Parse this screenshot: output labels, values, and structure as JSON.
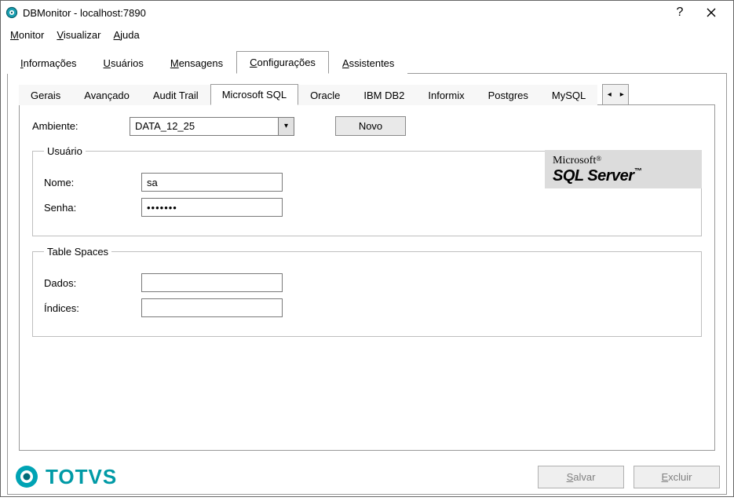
{
  "window": {
    "title": "DBMonitor - localhost:7890"
  },
  "menubar": [
    {
      "label": "Monitor",
      "accel_index": 0
    },
    {
      "label": "Visualizar",
      "accel_index": 0
    },
    {
      "label": "Ajuda",
      "accel_index": 0
    }
  ],
  "outer_tabs": {
    "items": [
      {
        "label": "Informações",
        "accel_index": 0
      },
      {
        "label": "Usuários",
        "accel_index": 0
      },
      {
        "label": "Mensagens",
        "accel_index": 0
      },
      {
        "label": "Configurações",
        "accel_index": 0,
        "active": true
      },
      {
        "label": "Assistentes",
        "accel_index": 0
      }
    ]
  },
  "inner_tabs": {
    "items": [
      {
        "label": "Gerais"
      },
      {
        "label": "Avançado"
      },
      {
        "label": "Audit Trail"
      },
      {
        "label": "Microsoft SQL",
        "active": true
      },
      {
        "label": "Oracle"
      },
      {
        "label": "IBM DB2"
      },
      {
        "label": "Informix"
      },
      {
        "label": "Postgres"
      },
      {
        "label": "MySQL"
      }
    ]
  },
  "form": {
    "ambiente_label": "Ambiente:",
    "ambiente_value": "DATA_12_25",
    "novo_label": "Novo",
    "usuario_legend": "Usuário",
    "nome_label": "Nome:",
    "nome_value": "sa",
    "senha_label": "Senha:",
    "senha_value": "•••••••",
    "tablespaces_legend": "Table Spaces",
    "dados_label": "Dados:",
    "dados_value": "",
    "indices_label": "Índices:",
    "indices_value": ""
  },
  "logo": {
    "microsoft": "Microsoft",
    "sqlserver": "SQL Server"
  },
  "footer": {
    "brand": "TOTVS",
    "salvar": "Salvar",
    "excluir": "Excluir"
  }
}
